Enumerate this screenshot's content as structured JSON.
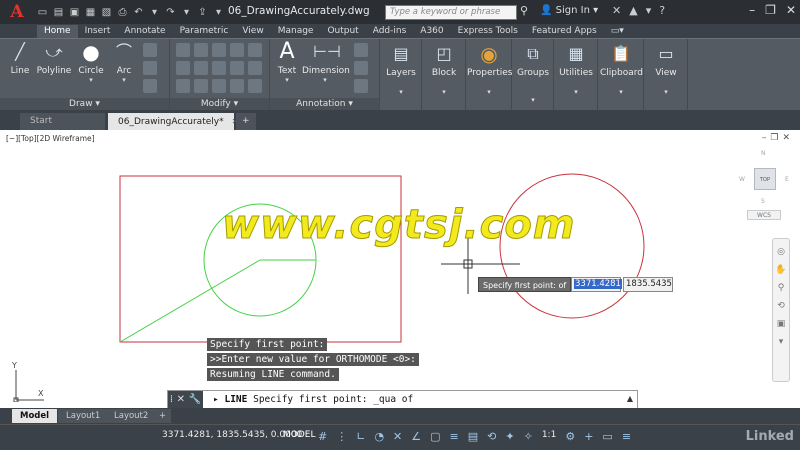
{
  "titlebar": {
    "app_letter": "A",
    "title": "06_DrawingAccurately.dwg",
    "search_placeholder": "Type a keyword or phrase",
    "signin": "Sign In"
  },
  "ribbon_tabs": [
    "Home",
    "Insert",
    "Annotate",
    "Parametric",
    "View",
    "Manage",
    "Output",
    "Add-ins",
    "A360",
    "Express Tools",
    "Featured Apps"
  ],
  "ribbon": {
    "draw_tools": [
      "Line",
      "Polyline",
      "Circle",
      "Arc"
    ],
    "draw_label": "Draw",
    "modify_label": "Modify",
    "annotation_tools": [
      "Text",
      "Dimension"
    ],
    "annotation_label": "Annotation",
    "big_tools": [
      "Layers",
      "Block",
      "Properties",
      "Groups",
      "Utilities",
      "Clipboard",
      "View"
    ]
  },
  "file_tabs": [
    "Start",
    "06_DrawingAccurately*"
  ],
  "viewport_label": "[−][Top][2D Wireframe]",
  "watermark": "www.cgtsj.com",
  "viewcube": {
    "top": "TOP",
    "n": "N",
    "s": "S",
    "e": "E",
    "w": "W",
    "wcs": "WCS"
  },
  "dynamic_input": {
    "prompt": "Specify first point: of",
    "x_value": "3371.4281",
    "y_value": "1835.5435"
  },
  "ucs": {
    "x": "X",
    "y": "Y"
  },
  "command_history": [
    "Specify first point:",
    ">>Enter new value for ORTHOMODE <0>:",
    "Resuming LINE command."
  ],
  "command_line": {
    "command": "LINE",
    "text": "Specify first point: _qua of"
  },
  "layout_tabs": [
    "Model",
    "Layout1",
    "Layout2"
  ],
  "statusbar": {
    "coords": "3371.4281, 1835.5435, 0.0000",
    "model": "MODEL",
    "scale": "1:1",
    "brand": "Linked"
  },
  "colors": {
    "rectangle": "#c8323c",
    "circle_left": "#46d246",
    "line": "#46d246",
    "circle_right": "#c8323c",
    "cursor": "#333333"
  }
}
